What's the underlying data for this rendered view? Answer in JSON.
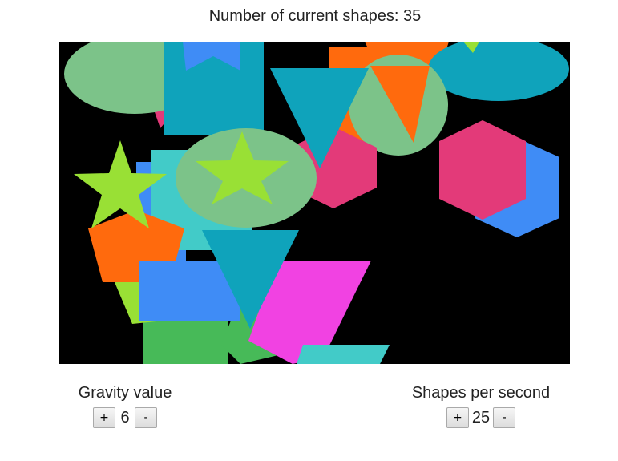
{
  "status": {
    "count_label": "Number of current shapes:",
    "count_value": "35"
  },
  "canvas": {
    "background": "#000000",
    "palette": [
      "#7cc389",
      "#0fa3bb",
      "#3f8cf6",
      "#e33a79",
      "#ff6a0d",
      "#99e035",
      "#42cbc8",
      "#47ba58",
      "#f142e2"
    ]
  },
  "controls": {
    "gravity": {
      "label": "Gravity value",
      "value": "6",
      "increment_label": "+",
      "decrement_label": "-"
    },
    "rate": {
      "label": "Shapes per second",
      "value": "25",
      "increment_label": "+",
      "decrement_label": "-"
    }
  }
}
